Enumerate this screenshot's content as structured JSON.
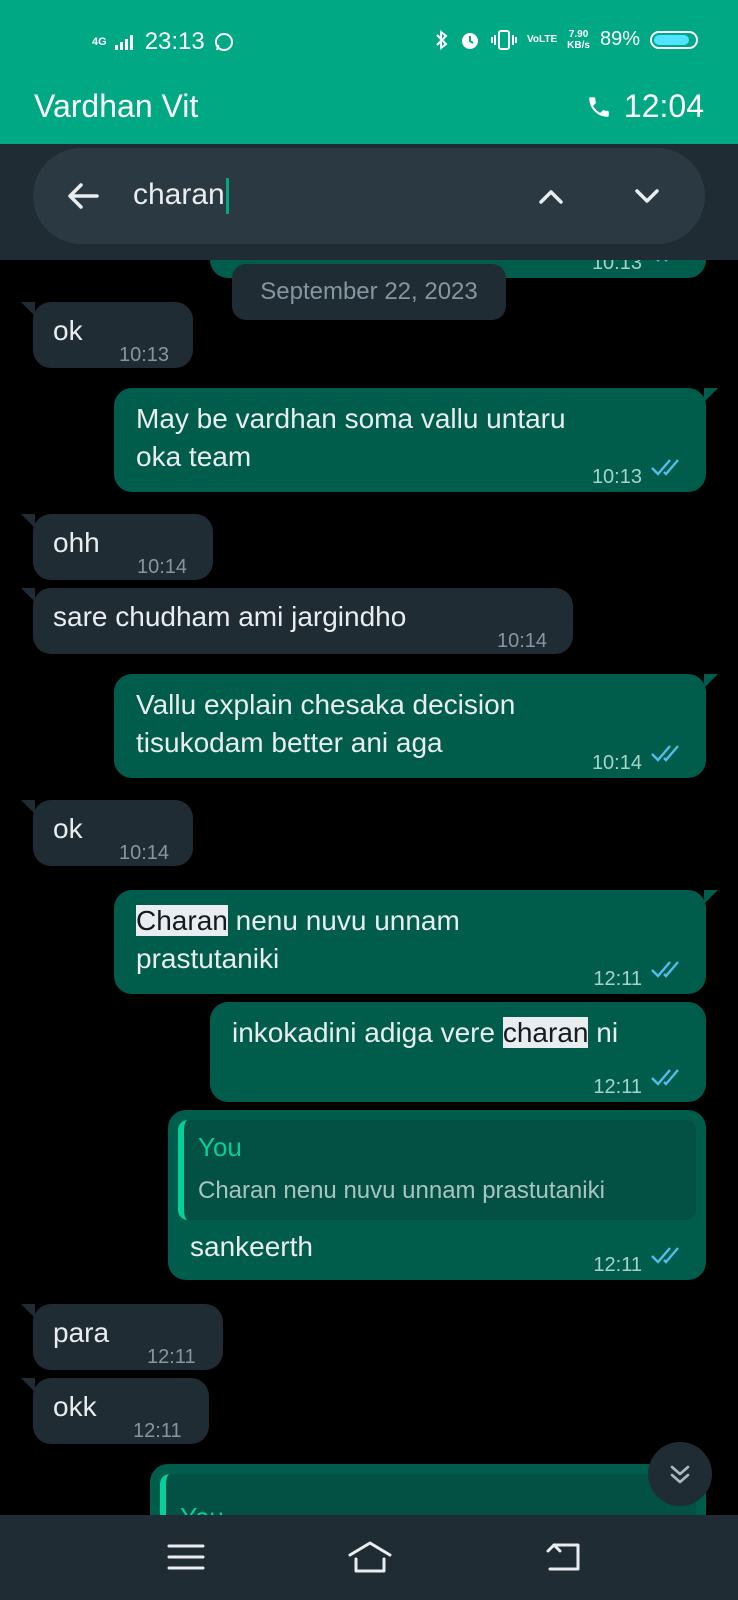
{
  "status": {
    "network": "4G",
    "time": "23:13",
    "volte": "VoLTE",
    "speed_value": "7.90",
    "speed_unit": "KB/s",
    "battery": "89%",
    "battery_level": 0.89
  },
  "header": {
    "contact_name": "Vardhan Vit",
    "call_time": "12:04"
  },
  "search": {
    "query": "charan"
  },
  "date_divider": "September 22, 2023",
  "top_partial_time": "10:13",
  "messages": [
    {
      "dir": "in",
      "text": "ok",
      "time": "10:13"
    },
    {
      "dir": "out",
      "line1": "May be vardhan soma vallu untaru",
      "line2": "oka team",
      "time": "10:13"
    },
    {
      "dir": "in",
      "text": "ohh",
      "time": "10:14"
    },
    {
      "dir": "in",
      "text": "sare chudham ami jargindho",
      "time": "10:14"
    },
    {
      "dir": "out",
      "line1": "Vallu explain chesaka decision",
      "line2": "tisukodam better ani aga",
      "time": "10:14"
    },
    {
      "dir": "in",
      "text": "ok",
      "time": "10:14"
    },
    {
      "dir": "out",
      "highlight": "Charan",
      "rest": " nenu nuvu unnam",
      "line2": "prastutaniki",
      "time": "12:11"
    },
    {
      "dir": "out",
      "before": "inkokadini adiga vere ",
      "highlight": "charan",
      "after": " ni",
      "time": "12:11"
    },
    {
      "dir": "out",
      "quote_author": "You",
      "quote_text": "Charan nenu nuvu unnam prastutaniki",
      "text": "sankeerth",
      "time": "12:11"
    },
    {
      "dir": "in",
      "text": "para",
      "time": "12:11"
    },
    {
      "dir": "in",
      "text": "okk",
      "time": "12:11"
    },
    {
      "dir": "out",
      "quote_author": "You"
    }
  ],
  "colors": {
    "brand": "#00a884",
    "outgoing_bubble": "#005c4b",
    "incoming_bubble": "#1f2c34",
    "read_ticks": "#53bdeb"
  },
  "icons": {
    "back": "arrow-left-icon",
    "up": "chevron-up-icon",
    "down": "chevron-down-icon",
    "scroll": "double-chevron-down-icon",
    "nav_menu": "menu-icon",
    "nav_home": "home-icon",
    "nav_back": "return-icon"
  }
}
